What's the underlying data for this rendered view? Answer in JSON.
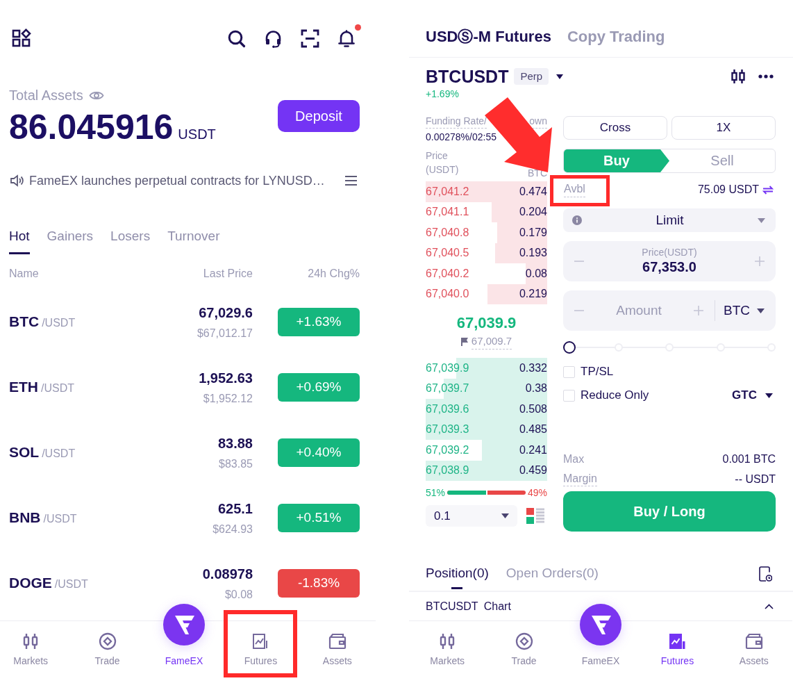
{
  "left_screen": {
    "top_bar": {
      "has_unread": true
    },
    "assets": {
      "label": "Total Assets",
      "amount": "86.045916",
      "unit": "USDT",
      "deposit_button": "Deposit"
    },
    "announcement": "FameEX launches perpetual contracts for LYNUSD…",
    "tabs": [
      {
        "label": "Hot",
        "selected": true
      },
      {
        "label": "Gainers",
        "selected": false
      },
      {
        "label": "Losers",
        "selected": false
      },
      {
        "label": "Turnover",
        "selected": false
      }
    ],
    "table": {
      "columns": [
        "Name",
        "Last Price",
        "24h Chg%"
      ],
      "rows": [
        {
          "base": "BTC",
          "quote": "/USDT",
          "price": "67,029.6",
          "usd_price": "$67,012.17",
          "change": "+1.63%",
          "color": "#15b77e"
        },
        {
          "base": "ETH",
          "quote": "/USDT",
          "price": "1,952.63",
          "usd_price": "$1,952.12",
          "change": "+0.69%",
          "color": "#15b77e"
        },
        {
          "base": "SOL",
          "quote": "/USDT",
          "price": "83.88",
          "usd_price": "$83.85",
          "change": "+0.40%",
          "color": "#15b77e"
        },
        {
          "base": "BNB",
          "quote": "/USDT",
          "price": "625.1",
          "usd_price": "$624.93",
          "change": "+0.51%",
          "color": "#15b77e"
        },
        {
          "base": "DOGE",
          "quote": "/USDT",
          "price": "0.08978",
          "usd_price": "$0.08",
          "change": "-1.83%",
          "color": "#e94747"
        }
      ]
    },
    "bottom_nav": [
      {
        "label": "Markets",
        "kind": "markets",
        "selected": false
      },
      {
        "label": "Trade",
        "kind": "trade",
        "selected": false
      },
      {
        "label": "FameEX",
        "kind": "home",
        "selected": true
      },
      {
        "label": "Futures",
        "kind": "futures",
        "selected": false
      },
      {
        "label": "Assets",
        "kind": "assets",
        "selected": false
      }
    ]
  },
  "right_screen": {
    "header_tabs": [
      {
        "label": "USDⓈ-M Futures",
        "selected": true
      },
      {
        "label": "Copy Trading",
        "selected": false
      }
    ],
    "symbol": {
      "name": "BTCUSDT",
      "badge": "Perp",
      "change": "+1.69%"
    },
    "order_book": {
      "funding_label": "Funding Rate/",
      "funding_label_tail": "own",
      "funding_value": "0.00278%/02:55",
      "price_header": "Price (USDT)",
      "amount_header_unit": "BTC",
      "asks": [
        {
          "price": "67,041.2",
          "amount": "0.474",
          "level": 1
        },
        {
          "price": "67,041.1",
          "amount": "0.204",
          "level": 0.46
        },
        {
          "price": "67,040.8",
          "amount": "0.179",
          "level": 0.41
        },
        {
          "price": "67,040.5",
          "amount": "0.193",
          "level": 0.43
        },
        {
          "price": "67,040.2",
          "amount": "0.08",
          "level": 0.18
        },
        {
          "price": "67,040.0",
          "amount": "0.219",
          "level": 0.49
        }
      ],
      "last_price": "67,039.9",
      "mark_price": "67,009.7",
      "bids": [
        {
          "price": "67,039.9",
          "amount": "0.332",
          "level": 0.75
        },
        {
          "price": "67,039.7",
          "amount": "0.38",
          "level": 0.85
        },
        {
          "price": "67,039.6",
          "amount": "0.508",
          "level": 1
        },
        {
          "price": "67,039.3",
          "amount": "0.485",
          "level": 1
        },
        {
          "price": "67,039.2",
          "amount": "0.241",
          "level": 0.54
        },
        {
          "price": "67,038.9",
          "amount": "0.459",
          "level": 1
        }
      ],
      "ratio": {
        "buy_label": "51%",
        "sell_label": "49%",
        "level": 0.51
      },
      "precision": "0.1"
    },
    "order_form": {
      "margin_mode": "Cross",
      "leverage": "1X",
      "sides": [
        {
          "label": "Buy",
          "selected": true
        },
        {
          "label": "Sell",
          "selected": false
        }
      ],
      "available_label": "Avbl",
      "available_value": "75.09 USDT",
      "order_type": "Limit",
      "price_field": {
        "label": "Price(USDT)",
        "value": "67,353.0"
      },
      "amount_field": {
        "placeholder": "Amount",
        "unit": "BTC"
      },
      "slider": {
        "level": 0
      },
      "options": [
        {
          "label": "TP/SL",
          "checked": false
        },
        {
          "label": "Reduce Only",
          "checked": false
        }
      ],
      "time_in_force": "GTC",
      "summary": [
        {
          "label": "Max",
          "value": "0.001 BTC",
          "has_hint": false
        },
        {
          "label": "Margin",
          "value": "-- USDT",
          "has_hint": true
        }
      ],
      "submit_button": "Buy / Long"
    },
    "position_tabs": [
      {
        "label": "Position(0)",
        "selected": true
      },
      {
        "label": "Open Orders(0)",
        "selected": false
      }
    ],
    "chart_section": {
      "label": "BTCUSDT Chart"
    },
    "bottom_nav": [
      {
        "label": "Markets",
        "kind": "markets",
        "selected": false
      },
      {
        "label": "Trade",
        "kind": "trade",
        "selected": false
      },
      {
        "label": "FameEX",
        "kind": "home",
        "selected": false
      },
      {
        "label": "Futures",
        "kind": "futures",
        "selected": true
      },
      {
        "label": "Assets",
        "kind": "assets",
        "selected": false
      }
    ]
  }
}
